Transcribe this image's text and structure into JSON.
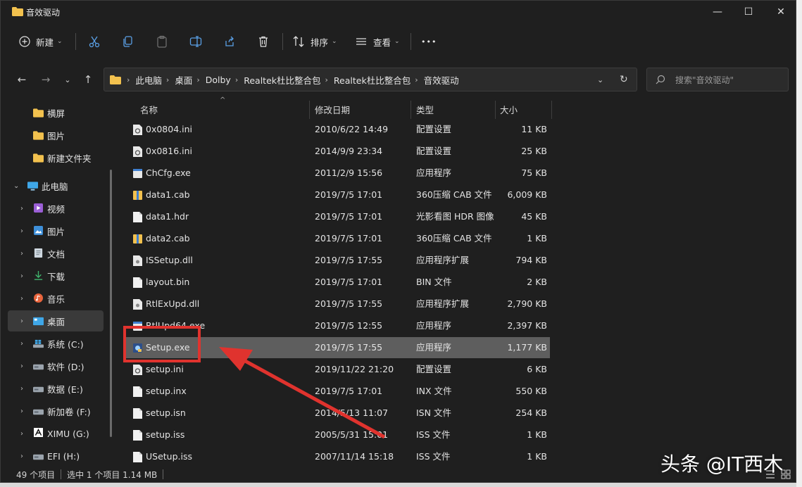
{
  "window": {
    "title": "音效驱动",
    "minimize": "—",
    "maximize": "☐",
    "close": "✕"
  },
  "toolbar": {
    "new_label": "新建",
    "sort_label": "排序",
    "view_label": "查看",
    "more": "•••"
  },
  "address": {
    "crumbs": [
      "此电脑",
      "桌面",
      "Dolby",
      "Realtek杜比整合包",
      "Realtek杜比整合包",
      "音效驱动"
    ],
    "search_placeholder": "搜索\"音效驱动\""
  },
  "sidebar": {
    "quick": [
      {
        "label": "横屏"
      },
      {
        "label": "图片"
      },
      {
        "label": "新建文件夹"
      }
    ],
    "this_pc": "此电脑",
    "items": [
      {
        "label": "视频",
        "icon": "video-icon"
      },
      {
        "label": "图片",
        "icon": "pictures-icon"
      },
      {
        "label": "文档",
        "icon": "documents-icon"
      },
      {
        "label": "下载",
        "icon": "downloads-icon"
      },
      {
        "label": "音乐",
        "icon": "music-icon"
      },
      {
        "label": "桌面",
        "icon": "desktop-icon"
      },
      {
        "label": "系统 (C:)",
        "icon": "drive-icon"
      },
      {
        "label": "软件 (D:)",
        "icon": "drive-icon"
      },
      {
        "label": "数据 (E:)",
        "icon": "drive-icon"
      },
      {
        "label": "新加卷 (F:)",
        "icon": "drive-icon"
      },
      {
        "label": "XIMU (G:)",
        "icon": "drive-icon"
      },
      {
        "label": "EFI (H:)",
        "icon": "drive-icon"
      }
    ]
  },
  "columns": {
    "name": "名称",
    "date": "修改日期",
    "type": "类型",
    "size": "大小"
  },
  "files": [
    {
      "name": "0x0804.ini",
      "date": "2010/6/22 14:49",
      "type": "配置设置",
      "size": "11 KB",
      "icon": "settings-file-icon"
    },
    {
      "name": "0x0816.ini",
      "date": "2014/9/9 23:34",
      "type": "配置设置",
      "size": "25 KB",
      "icon": "settings-file-icon"
    },
    {
      "name": "ChCfg.exe",
      "date": "2011/2/9 15:56",
      "type": "应用程序",
      "size": "75 KB",
      "icon": "exe-icon"
    },
    {
      "name": "data1.cab",
      "date": "2019/7/5 17:01",
      "type": "360压缩 CAB 文件",
      "size": "6,009 KB",
      "icon": "cab-icon"
    },
    {
      "name": "data1.hdr",
      "date": "2019/7/5 17:01",
      "type": "光影看图 HDR 图像",
      "size": "45 KB",
      "icon": "file-icon"
    },
    {
      "name": "data2.cab",
      "date": "2019/7/5 17:01",
      "type": "360压缩 CAB 文件",
      "size": "1 KB",
      "icon": "cab-icon"
    },
    {
      "name": "ISSetup.dll",
      "date": "2019/7/5 17:55",
      "type": "应用程序扩展",
      "size": "794 KB",
      "icon": "dll-icon"
    },
    {
      "name": "layout.bin",
      "date": "2019/7/5 17:01",
      "type": "BIN 文件",
      "size": "2 KB",
      "icon": "file-icon"
    },
    {
      "name": "RtlExUpd.dll",
      "date": "2019/7/5 17:55",
      "type": "应用程序扩展",
      "size": "2,790 KB",
      "icon": "dll-icon"
    },
    {
      "name": "RtlUpd64.exe",
      "date": "2019/7/5 12:55",
      "type": "应用程序",
      "size": "2,397 KB",
      "icon": "exe-icon"
    },
    {
      "name": "Setup.exe",
      "date": "2019/7/5 17:55",
      "type": "应用程序",
      "size": "1,177 KB",
      "icon": "setup-exe-icon"
    },
    {
      "name": "setup.ini",
      "date": "2019/11/22 21:20",
      "type": "配置设置",
      "size": "6 KB",
      "icon": "settings-file-icon"
    },
    {
      "name": "setup.inx",
      "date": "2019/7/5 17:01",
      "type": "INX 文件",
      "size": "550 KB",
      "icon": "file-icon"
    },
    {
      "name": "setup.isn",
      "date": "2014/5/13 11:07",
      "type": "ISN 文件",
      "size": "254 KB",
      "icon": "file-icon"
    },
    {
      "name": "setup.iss",
      "date": "2005/5/31 15:01",
      "type": "ISS 文件",
      "size": "1 KB",
      "icon": "file-icon"
    },
    {
      "name": "USetup.iss",
      "date": "2007/11/14 15:18",
      "type": "ISS 文件",
      "size": "1 KB",
      "icon": "file-icon"
    }
  ],
  "status": {
    "count": "49 个项目",
    "selection": "选中 1 个项目  1.14 MB"
  },
  "watermark": "头条 @IT西木",
  "colors": {
    "highlight": "#e0332e",
    "folder": "#f2c14e",
    "selected_row": "#5e5e5e"
  }
}
